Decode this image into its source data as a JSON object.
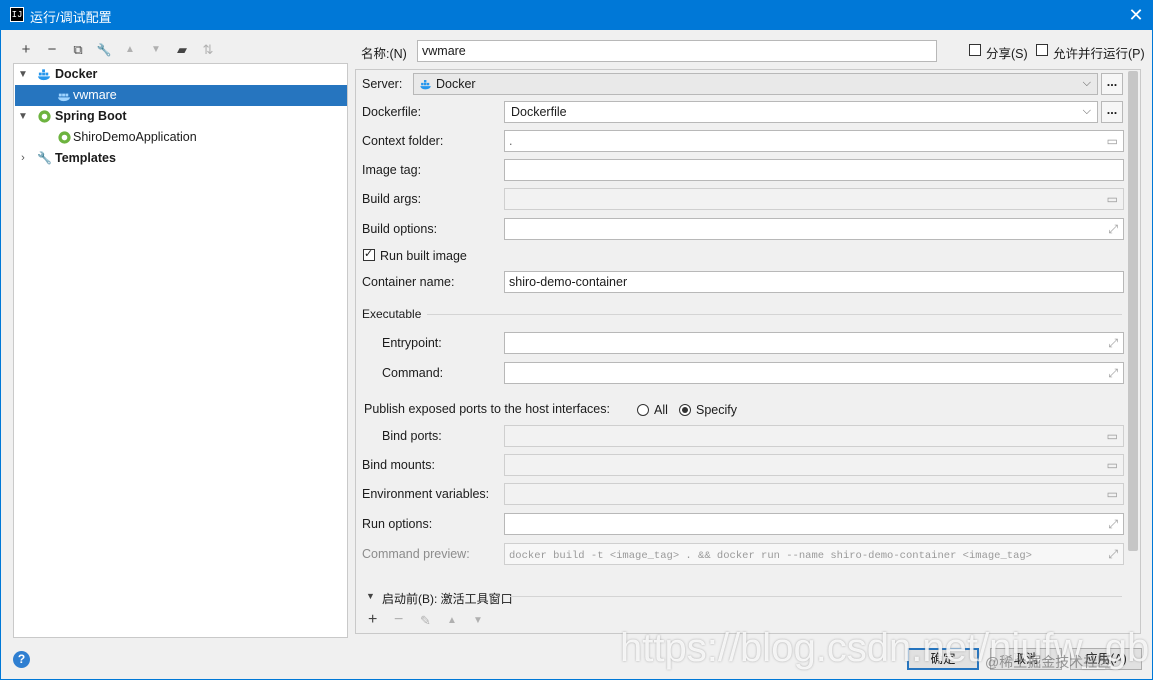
{
  "window": {
    "title": "运行/调试配置",
    "close_glyph": "✕",
    "app_icon_text": "IJ"
  },
  "toolbar": [
    {
      "icon": "add-icon",
      "glyph": "+",
      "enabled": true
    },
    {
      "icon": "remove-icon",
      "glyph": "−",
      "enabled": true
    },
    {
      "icon": "copy-icon",
      "glyph": "⧉",
      "enabled": true
    },
    {
      "icon": "wrench-icon",
      "glyph": "🔧",
      "enabled": true
    },
    {
      "icon": "move-up-icon",
      "glyph": "▲",
      "enabled": false
    },
    {
      "icon": "move-down-icon",
      "glyph": "▼",
      "enabled": false
    },
    {
      "icon": "new-folder-icon",
      "glyph": "▰",
      "enabled": true
    },
    {
      "icon": "sort-icon",
      "glyph": "⇅",
      "enabled": false
    }
  ],
  "tree": {
    "docker": {
      "label": "Docker",
      "expanded": true
    },
    "vwmare": {
      "label": "vwmare",
      "selected": true
    },
    "spring_boot": {
      "label": "Spring Boot",
      "expanded": true
    },
    "shiro": {
      "label": "ShiroDemoApplication"
    },
    "templates": {
      "label": "Templates",
      "expanded": false
    }
  },
  "name": {
    "label": "名称:(N)",
    "value": "vwmare"
  },
  "share": {
    "label": "分享(S)",
    "checked": false
  },
  "parallel": {
    "label": "允许并行运行(P)",
    "checked": false
  },
  "form": {
    "server": {
      "label": "Server:",
      "value": "Docker"
    },
    "dockerfile": {
      "label": "Dockerfile:",
      "value": "Dockerfile"
    },
    "context_folder": {
      "label": "Context folder:",
      "value": "."
    },
    "image_tag": {
      "label": "Image tag:",
      "value": ""
    },
    "build_args": {
      "label": "Build args:",
      "value": ""
    },
    "build_options": {
      "label": "Build options:",
      "value": ""
    },
    "run_built_image": {
      "label": "Run built image",
      "checked": true
    },
    "container_name": {
      "label": "Container name:",
      "value": "shiro-demo-container"
    },
    "executable": {
      "label": "Executable"
    },
    "entrypoint": {
      "label": "Entrypoint:",
      "value": ""
    },
    "command": {
      "label": "Command:",
      "value": ""
    },
    "publish_ports": {
      "label": "Publish exposed ports to the host interfaces:",
      "option_all": "All",
      "option_specify": "Specify",
      "selected": "Specify"
    },
    "bind_ports": {
      "label": "Bind ports:",
      "value": ""
    },
    "bind_mounts": {
      "label": "Bind mounts:",
      "value": ""
    },
    "env_vars": {
      "label": "Environment variables:",
      "value": ""
    },
    "run_options": {
      "label": "Run options:",
      "value": ""
    },
    "command_preview": {
      "label": "Command preview:",
      "value": "docker build -t <image_tag> . && docker run --name shiro-demo-container <image_tag>"
    }
  },
  "before_launch": {
    "label": "启动前(B): 激活工具窗口"
  },
  "buttons": {
    "ok": "确定",
    "cancel": "取消",
    "apply": "应用(A)",
    "help": "?"
  },
  "watermark": {
    "text": "https://blog.csdn.net/niufw_gb",
    "sub": "@稀土掘金技术社区"
  },
  "colors": {
    "accent": "#0078d7",
    "selection": "#2675bf",
    "docker_blue": "#2496ed",
    "spring_green": "#6db33f"
  }
}
